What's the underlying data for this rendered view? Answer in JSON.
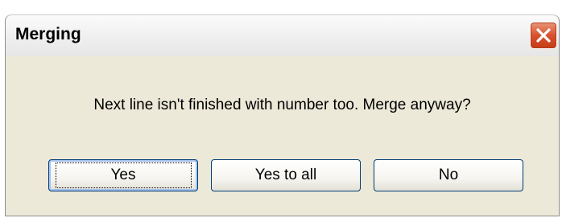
{
  "window": {
    "title": "Merging",
    "close_icon": "close-icon"
  },
  "message": "Next line isn't finished with number too. Merge anyway?",
  "buttons": {
    "yes": "Yes",
    "yes_to_all": "Yes to all",
    "no": "No"
  },
  "colors": {
    "dialog_bg": "#ece9d8",
    "close_button": "#d8522f",
    "button_border": "#003c74"
  }
}
